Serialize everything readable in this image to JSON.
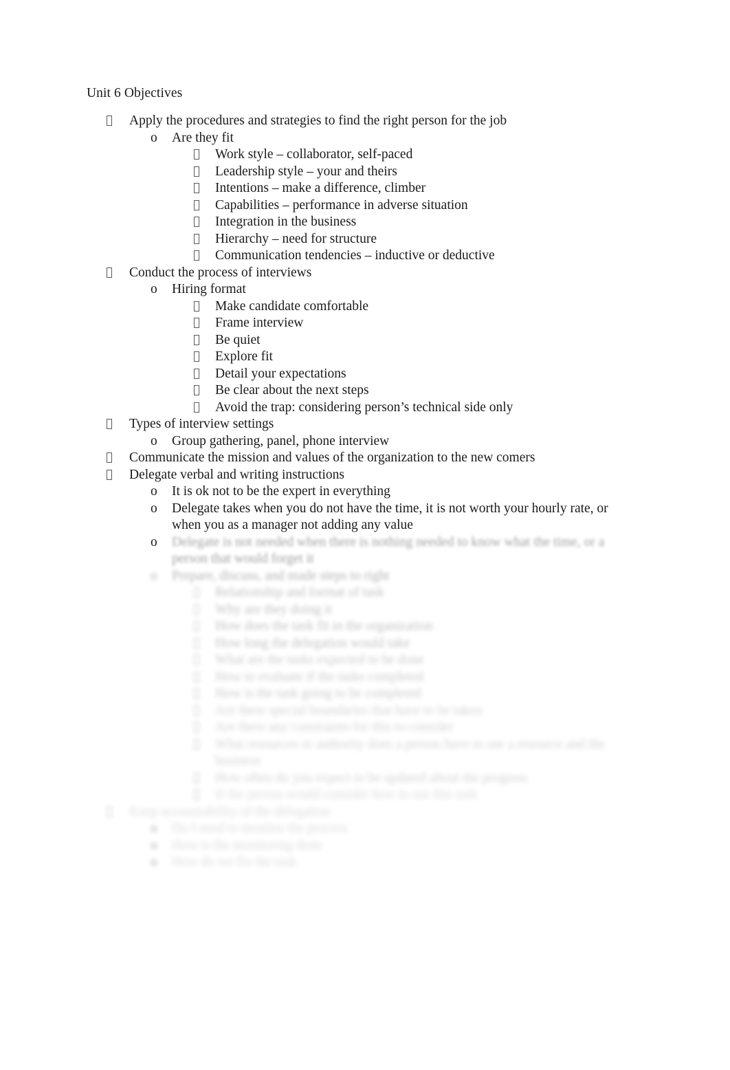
{
  "document": {
    "title": "Unit 6 Objectives",
    "background_color": "#ffffff",
    "text_color": "#1a1a1a",
    "bullet_glyph_color": "#595959",
    "bullet_level1_icon": "tofu-box-bullet",
    "bullet_level2_icon": "lowercase-o-bullet",
    "bullet_level3_icon": "tofu-box-bullet",
    "bullet_level2_char": "o"
  },
  "outline": [
    {
      "level": 1,
      "text": "Apply the procedures and strategies to find the right person for the job",
      "blur": 0
    },
    {
      "level": 2,
      "text": "Are they fit",
      "blur": 0
    },
    {
      "level": 3,
      "text": "Work style – collaborator, self-paced",
      "blur": 0
    },
    {
      "level": 3,
      "text": "Leadership style – your and theirs",
      "blur": 0
    },
    {
      "level": 3,
      "text": "Intentions – make a difference, climber",
      "blur": 0
    },
    {
      "level": 3,
      "text": "Capabilities – performance in adverse situation",
      "blur": 0
    },
    {
      "level": 3,
      "text": "Integration in the business",
      "blur": 0
    },
    {
      "level": 3,
      "text": "Hierarchy – need for structure",
      "blur": 0
    },
    {
      "level": 3,
      "text": "Communication tendencies – inductive or deductive",
      "blur": 0
    },
    {
      "level": 1,
      "text": "Conduct the process of interviews",
      "blur": 0
    },
    {
      "level": 2,
      "text": "Hiring format",
      "blur": 0
    },
    {
      "level": 3,
      "text": "Make candidate comfortable",
      "blur": 0
    },
    {
      "level": 3,
      "text": "Frame interview",
      "blur": 0
    },
    {
      "level": 3,
      "text": "Be quiet",
      "blur": 0
    },
    {
      "level": 3,
      "text": "Explore fit",
      "blur": 0
    },
    {
      "level": 3,
      "text": "Detail your expectations",
      "blur": 0
    },
    {
      "level": 3,
      "text": "Be clear about the next steps",
      "blur": 0
    },
    {
      "level": 3,
      "text": "Avoid the trap: considering person’s technical side only",
      "blur": 0
    },
    {
      "level": 1,
      "text": "Types of interview settings",
      "blur": 0
    },
    {
      "level": 2,
      "text": "Group gathering, panel, phone interview",
      "blur": 0
    },
    {
      "level": 1,
      "text": "Communicate the mission and values of the organization to the new comers",
      "blur": 0
    },
    {
      "level": 1,
      "text": "Delegate verbal and writing instructions",
      "blur": 0
    },
    {
      "level": 2,
      "text": "It is ok not to be the expert in everything",
      "blur": 0
    },
    {
      "level": 2,
      "text": "Delegate takes when you do not have the time, it is not worth your hourly rate, or when you as a manager not adding any value",
      "blur": 0
    },
    {
      "level": 2,
      "text": "Delegate is not needed when there is nothing needed to know what the time, or a person that would forget it",
      "blur": 1
    },
    {
      "level": 2,
      "text": "Prepare, discuss, and made steps to right",
      "blur": 2
    },
    {
      "level": 3,
      "text": "Relationship and format of task",
      "blur": 3
    },
    {
      "level": 3,
      "text": "Why are they doing it",
      "blur": 3
    },
    {
      "level": 3,
      "text": "How does the task fit in the organization",
      "blur": 3
    },
    {
      "level": 3,
      "text": "How long the delegation would take",
      "blur": 3
    },
    {
      "level": 3,
      "text": "What are the tasks expected to be done",
      "blur": 4
    },
    {
      "level": 3,
      "text": "How to evaluate if the tasks completed",
      "blur": 4
    },
    {
      "level": 3,
      "text": "How is the task going to be completed",
      "blur": 4
    },
    {
      "level": 3,
      "text": "Are there special boundaries that have to be taken",
      "blur": 5
    },
    {
      "level": 3,
      "text": "Are there any constraints for this to consider",
      "blur": 5
    },
    {
      "level": 3,
      "text": "What resources or authority does a person have to use a resource and the business",
      "blur": 5
    },
    {
      "level": 3,
      "text": "How often do you expect to be updated about the progress",
      "blur": 5
    },
    {
      "level": 3,
      "text": "If the person would consider how to use this task",
      "blur": 6
    },
    {
      "level": 1,
      "text": "Keep accountability of the delegation",
      "blur": 6
    },
    {
      "level": 2,
      "text": "Do I need to monitor the process",
      "blur": 6
    },
    {
      "level": 2,
      "text": "How is the monitoring done",
      "blur": 6
    },
    {
      "level": 2,
      "text": "How do we fix the task",
      "blur": 6
    }
  ]
}
